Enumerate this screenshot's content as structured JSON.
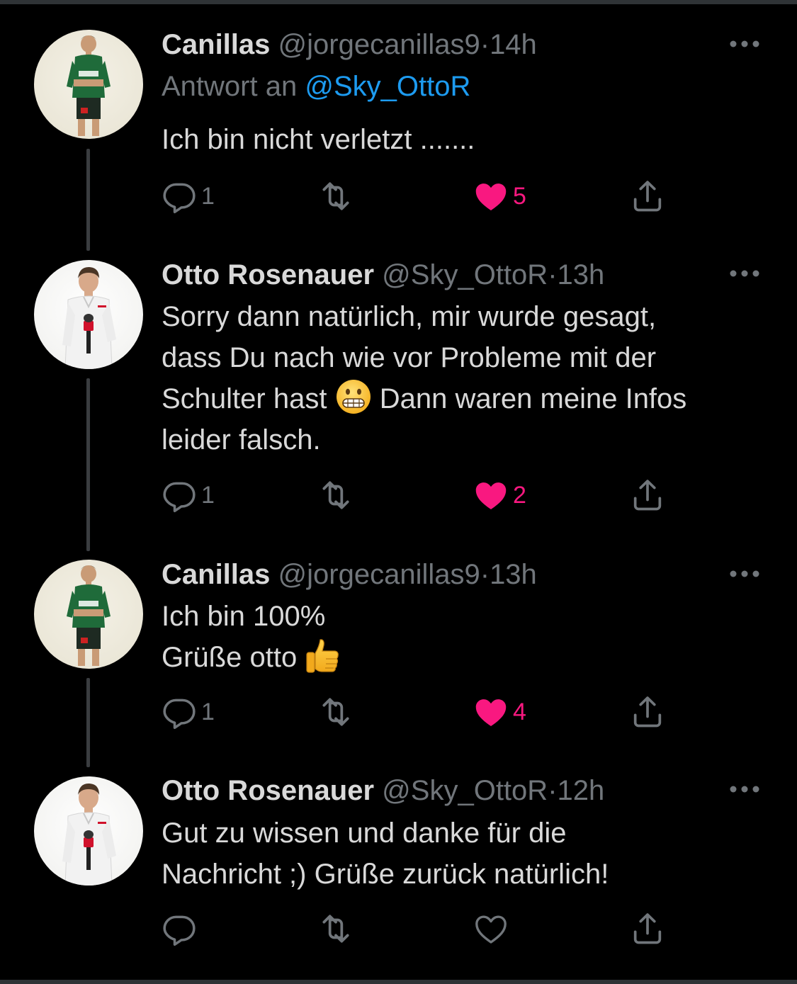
{
  "colors": {
    "background": "#000000",
    "text": "#d9d9d9",
    "secondary": "#71767b",
    "link": "#1d9bf0",
    "like": "#f91880",
    "thread_line": "#3a3d40"
  },
  "tweets": [
    {
      "name": "Canillas",
      "handle": "@jorgecanillas9",
      "dot": "·",
      "time": "14h",
      "reply_prefix": "Antwort an",
      "reply_mention": "@Sky_OttoR",
      "lines": [
        "Ich bin nicht verletzt ......."
      ],
      "reply_count": "1",
      "retweet_count": "",
      "like_count": "5",
      "liked": true,
      "avatar_icon": "player-avatar"
    },
    {
      "name": "Otto Rosenauer",
      "handle": "@Sky_OttoR",
      "dot": "·",
      "time": "13h",
      "lines": [
        "Sorry dann natürlich, mir wurde gesagt,",
        "dass Du nach wie vor Probleme mit der",
        "Schulter hast",
        "Dann waren meine Infos",
        "leider falsch."
      ],
      "emoji": "grimacing-face",
      "reply_count": "1",
      "retweet_count": "",
      "like_count": "2",
      "liked": true,
      "avatar_icon": "reporter-avatar"
    },
    {
      "name": "Canillas",
      "handle": "@jorgecanillas9",
      "dot": "·",
      "time": "13h",
      "lines": [
        "Ich bin 100%",
        "Grüße otto"
      ],
      "emoji": "thumbs-up",
      "reply_count": "1",
      "retweet_count": "",
      "like_count": "4",
      "liked": true,
      "avatar_icon": "player-avatar"
    },
    {
      "name": "Otto Rosenauer",
      "handle": "@Sky_OttoR",
      "dot": "·",
      "time": "12h",
      "lines": [
        "Gut zu wissen und danke für die",
        "Nachricht ;) Grüße zurück natürlich!"
      ],
      "reply_count": "",
      "retweet_count": "",
      "like_count": "",
      "liked": false,
      "avatar_icon": "reporter-avatar"
    }
  ]
}
